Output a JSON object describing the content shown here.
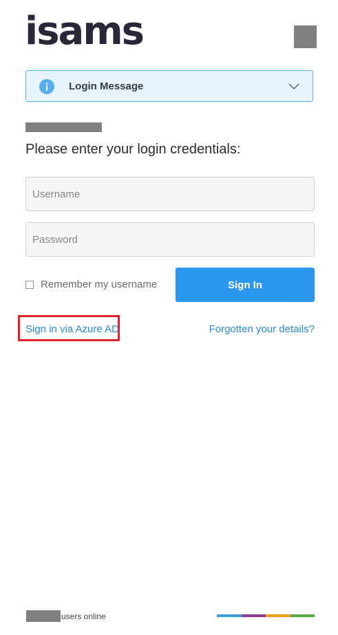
{
  "header": {
    "logo_text": "isams"
  },
  "login_message": {
    "label": "Login Message",
    "icon": "info-icon",
    "toggle_icon": "chevron-down-icon",
    "accent": "#56aeee",
    "background": "#e6f3fc"
  },
  "form": {
    "prompt": "Please enter your login credentials:",
    "username_placeholder": "Username",
    "username_value": "",
    "password_placeholder": "Password",
    "password_value": "",
    "remember_label": "Remember my username",
    "remember_checked": false,
    "signin_label": "Sign In",
    "signin_color": "#2c97ee"
  },
  "links": {
    "azure_label": "Sign in via Azure AD",
    "forgot_label": "Forgotten your details?",
    "link_color": "#2a8ad6",
    "highlight_color": "#e0202a"
  },
  "footer": {
    "users_online_label": "users online",
    "brand_colors": [
      "#3aa0dc",
      "#8a3b8f",
      "#f29b1d",
      "#58a745"
    ]
  }
}
